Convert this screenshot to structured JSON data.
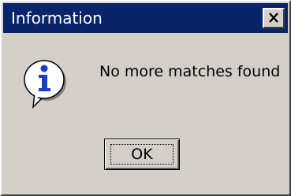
{
  "window": {
    "title": "Information"
  },
  "dialog": {
    "icon": "information-icon",
    "message": "No more matches found",
    "ok_label": "OK"
  },
  "colors": {
    "titlebar": "#0a246a",
    "face": "#d4d0c8",
    "title_text": "#ffffff",
    "icon_blue": "#1a3cc8"
  }
}
